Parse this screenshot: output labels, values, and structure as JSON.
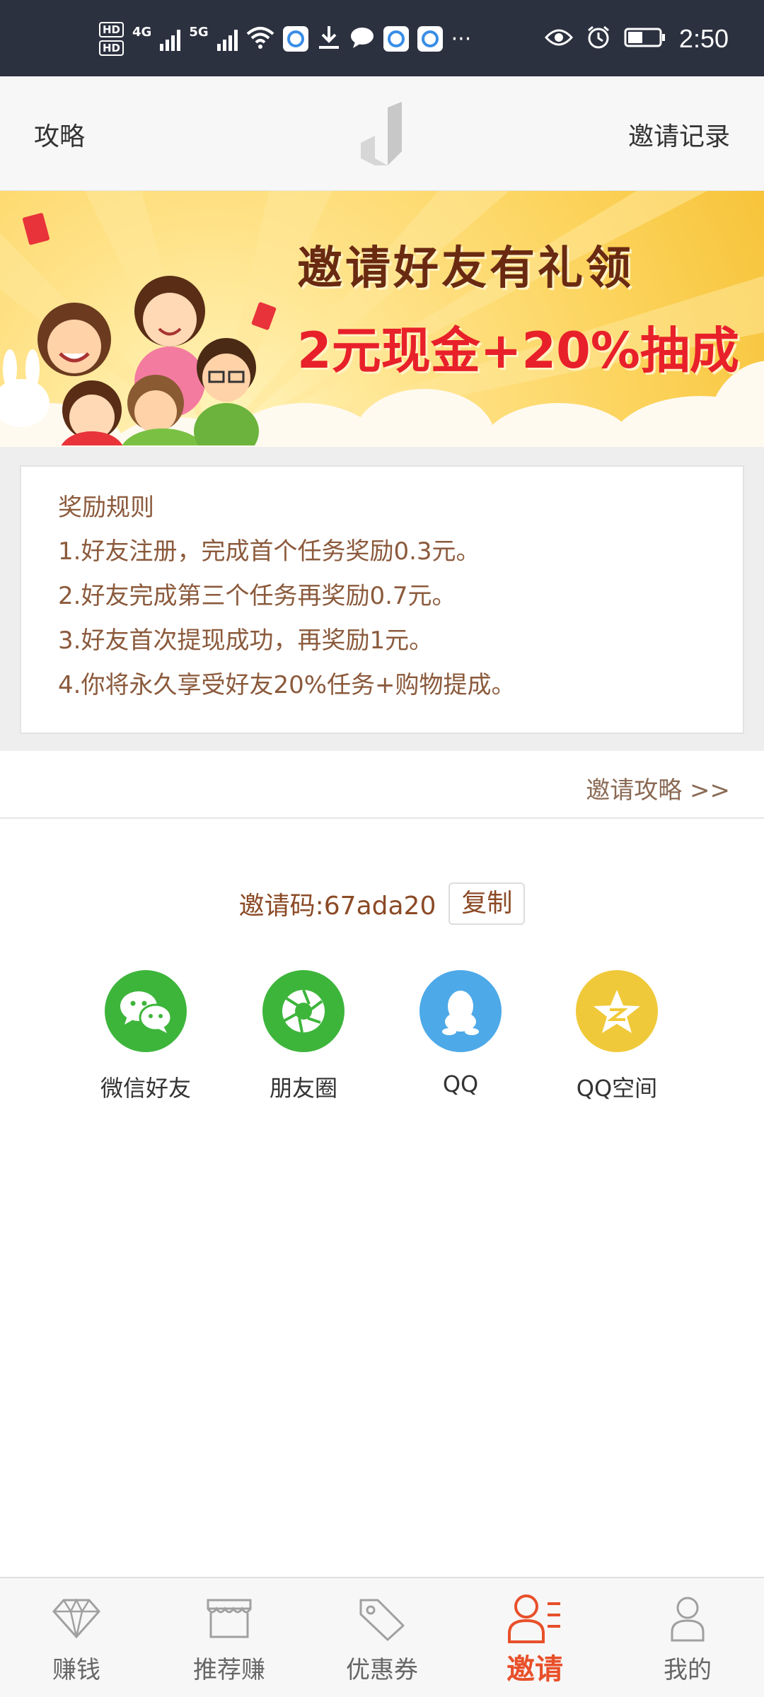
{
  "status_bar": {
    "hd1": "HD",
    "hd2": "HD",
    "net1": "4G",
    "net2": "5G",
    "time": "2:50"
  },
  "header": {
    "left_link": "攻略",
    "right_link": "邀请记录"
  },
  "banner": {
    "title": "邀请好友有礼领",
    "subtitle": "2元现金+20%抽成"
  },
  "rules": {
    "title": "奖励规则",
    "items": [
      "1.好友注册，完成首个任务奖励0.3元。",
      "2.好友完成第三个任务再奖励0.7元。",
      "3.好友首次提现成功，再奖励1元。",
      "4.你将永久享受好友20%任务+购物提成。"
    ]
  },
  "strategy": {
    "link": "邀请攻略 >>"
  },
  "invite": {
    "label": "邀请码:67ada20",
    "copy_button": "复制"
  },
  "share": [
    {
      "label": "微信好友",
      "icon": "wechat-icon",
      "color": "#3db53b"
    },
    {
      "label": "朋友圈",
      "icon": "moments-icon",
      "color": "#3db53b"
    },
    {
      "label": "QQ",
      "icon": "qq-icon",
      "color": "#4da9e8"
    },
    {
      "label": "QQ空间",
      "icon": "qzone-icon",
      "color": "#f0c93a"
    }
  ],
  "nav": {
    "items": [
      {
        "label": "赚钱",
        "icon": "diamond-icon"
      },
      {
        "label": "推荐赚",
        "icon": "shop-icon"
      },
      {
        "label": "优惠券",
        "icon": "tag-icon"
      },
      {
        "label": "邀请",
        "icon": "invite-user-icon",
        "active": true
      },
      {
        "label": "我的",
        "icon": "profile-icon"
      }
    ],
    "active_color": "#e8502a"
  }
}
